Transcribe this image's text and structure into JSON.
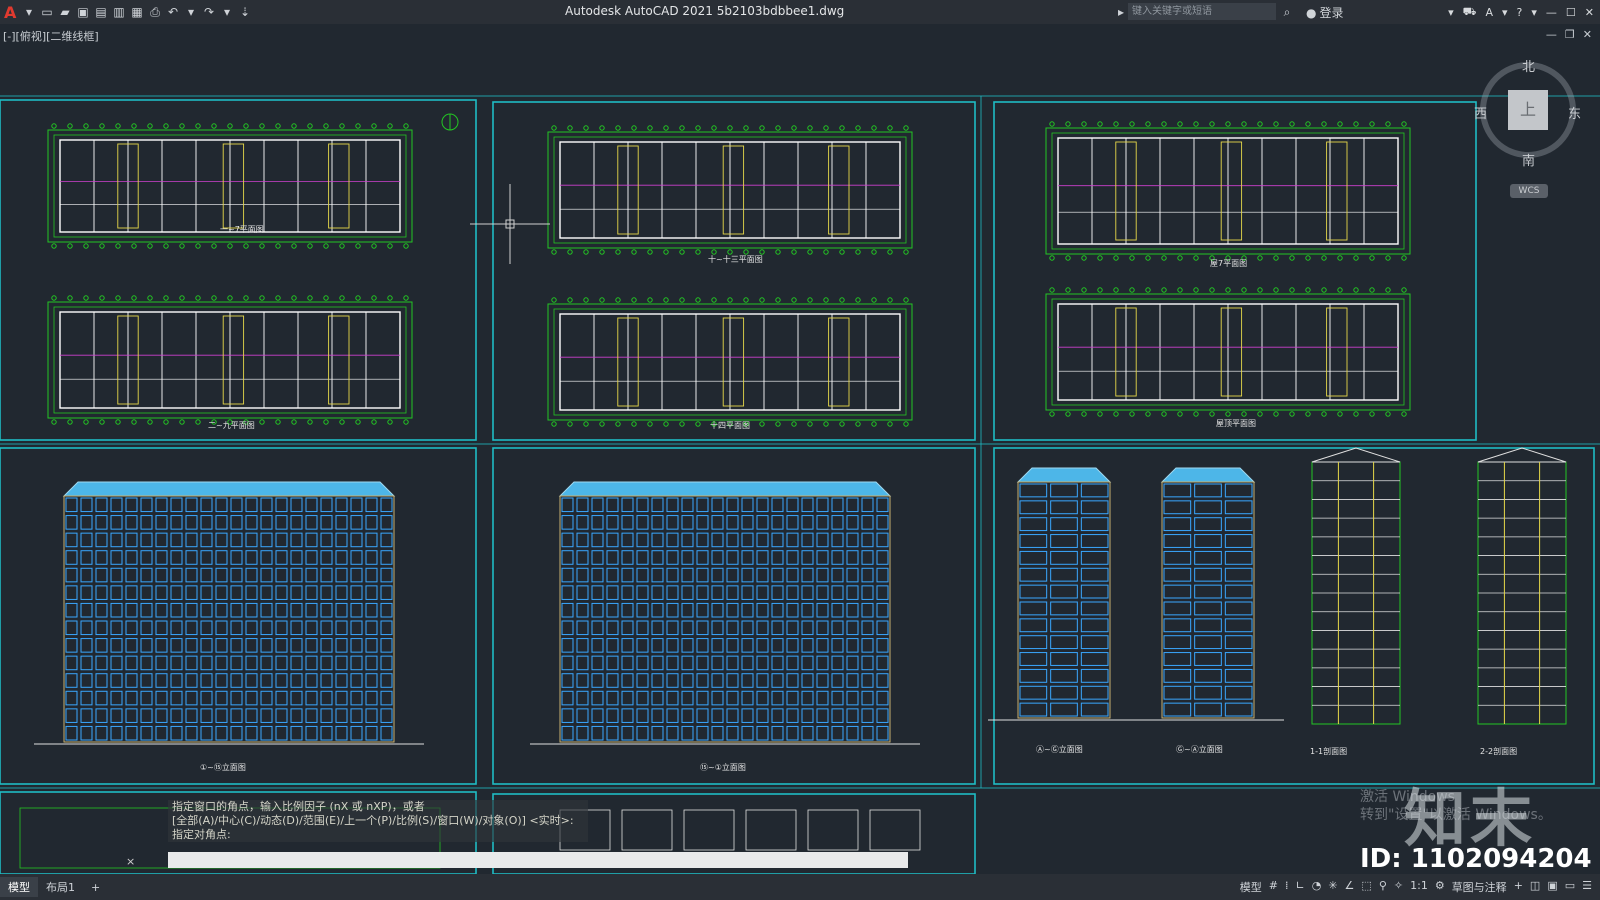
{
  "app": {
    "title": "Autodesk AutoCAD 2021    5b2103bdbbee1.dwg",
    "logo": "A",
    "search_placeholder": "键入关键字或短语",
    "signin_label": "登录",
    "view_label": "[-][俯视][二维线框]"
  },
  "viewcube": {
    "north": "北",
    "south": "南",
    "east": "东",
    "west": "西",
    "top_face": "上",
    "wcs": "WCS"
  },
  "drawings": {
    "plan_a_top": "一~7平面图",
    "plan_a_bottom": "二~九平面图",
    "plan_b_top": "十~十三平面图",
    "plan_b_bottom": "十四平面图",
    "plan_c_top": "屋7平面图",
    "plan_c_bottom": "屋顶平面图",
    "elev_a": "①~⑮立面图",
    "elev_b": "⑮~①立面图",
    "side_a": "Ⓐ~Ⓖ立面图",
    "side_b": "Ⓖ~Ⓐ立面图",
    "section_1": "1-1剖面图",
    "section_2": "2-2剖面图"
  },
  "command": {
    "line1": "指定窗口的角点，输入比例因子 (nX 或 nXP)，或者",
    "line2": "[全部(A)/中心(C)/动态(D)/范围(E)/上一个(P)/比例(S)/窗口(W)/对象(O)] <实时>:",
    "line3": "指定对角点:",
    "close_icon": "×"
  },
  "statusbar": {
    "tab_model": "模型",
    "tab_layout1": "布局1",
    "add_tab": "+",
    "model_label": "模型",
    "scale": "1:1",
    "annotation": "草图与注释"
  },
  "overlay": {
    "activate_line1": "激活 Windows",
    "activate_line2": "转到\"设置\"以激活 Windows。",
    "brand_logo": "知末",
    "id_text": "ID: 1102094204"
  },
  "colors": {
    "canvas": "#212830",
    "frame": "#1fbcc4",
    "plan_lines": "#23c623",
    "wall": "#ffffff",
    "elevation_window": "#3aa7ff",
    "roof": "#4db6e8"
  }
}
